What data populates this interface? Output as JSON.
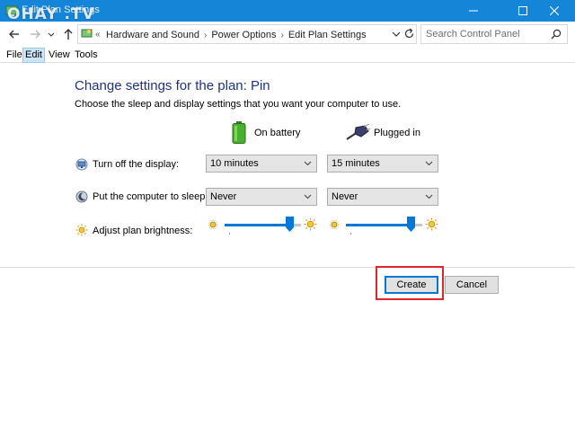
{
  "window": {
    "title": "Edit Plan Settings",
    "watermark": "OHAY .TV",
    "minimize_glyph": "—",
    "maximize_glyph": "☐",
    "close_glyph": "✕"
  },
  "address": {
    "overflow": "«",
    "breadcrumbs": [
      "Hardware and Sound",
      "Power Options",
      "Edit Plan Settings"
    ],
    "separator": "›",
    "search_placeholder": "Search Control Panel"
  },
  "menu": {
    "items": [
      "File",
      "Edit",
      "View",
      "Tools"
    ],
    "active": "Edit"
  },
  "content": {
    "heading": "Change settings for the plan: Pin",
    "description": "Choose the sleep and display settings that you want your computer to use.",
    "columns": {
      "battery": "On battery",
      "plugged": "Plugged in"
    },
    "rows": {
      "display": {
        "label": "Turn off the display:",
        "battery_value": "10 minutes",
        "plugged_value": "15 minutes"
      },
      "sleep": {
        "label": "Put the computer to sleep:",
        "battery_value": "Never",
        "plugged_value": "Never"
      },
      "brightness": {
        "label": "Adjust plan brightness:",
        "battery_level": 0.85,
        "plugged_level": 0.85
      }
    }
  },
  "buttons": {
    "create": "Create",
    "cancel": "Cancel"
  },
  "colors": {
    "titlebar": "#1585d8",
    "heading": "#1e3287",
    "accent": "#0078d7",
    "highlight": "#e0252b"
  },
  "icons": [
    "control-panel-icon",
    "back-arrow-icon",
    "forward-arrow-icon",
    "recent-chevron-icon",
    "up-arrow-icon",
    "refresh-icon",
    "search-icon",
    "battery-icon",
    "power-plug-icon",
    "monitor-icon",
    "moon-icon",
    "sun-icon"
  ]
}
